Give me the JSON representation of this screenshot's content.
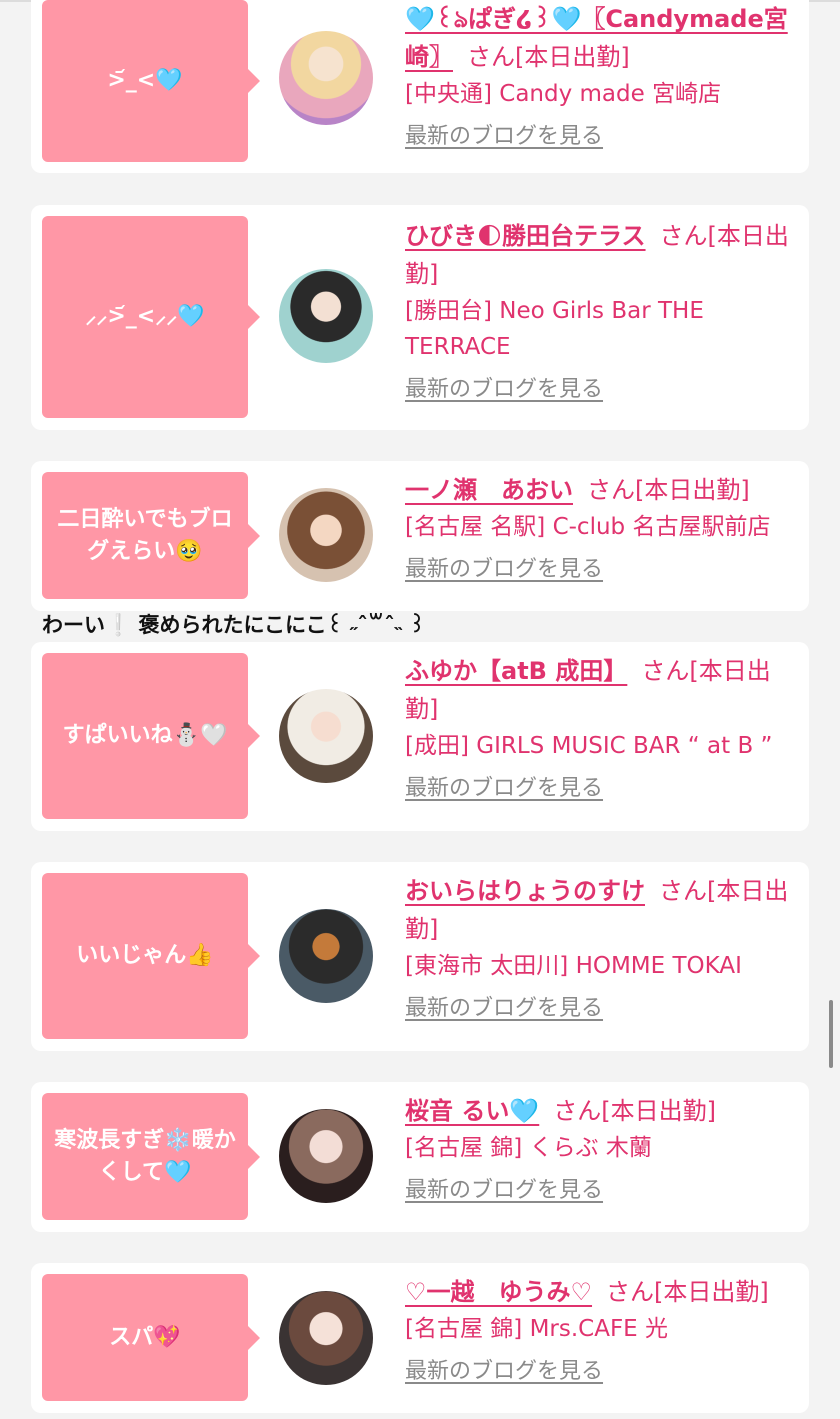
{
  "colors": {
    "accent": "#e0336e",
    "bubble": "#ff97a6",
    "link_gray": "#8a8a8a"
  },
  "between_text": "わーい❕ 褒められたにこにこ꒰ ˶ˆ꒳ˆ˵ ꒱",
  "posts": [
    {
      "bubble": ">᷄_<🩵",
      "name": "🩵꒰ঌぱぎ໒꒱🩵〖Candymade宮崎〗",
      "san": "さん[本日出勤]",
      "shop": "[中央通] Candy made 宮崎店",
      "blog": "最新のブログを見る",
      "avatar_icon": "avatar-photo"
    },
    {
      "bubble": "⸝⸝>᷄_<⸝⸝🩵",
      "name": "ひびき🌓勝田台テラス",
      "san": "さん[本日出勤]",
      "shop": "[勝田台] Neo Girls Bar THE TERRACE",
      "blog": "最新のブログを見る",
      "avatar_icon": "avatar-photo"
    },
    {
      "bubble": "二日酔いでもブログえらい🥹",
      "name": "一ノ瀬　あおい",
      "san": "さん[本日出勤]",
      "shop": "[名古屋 名駅] C-club 名古屋駅前店",
      "blog": "最新のブログを見る",
      "avatar_icon": "avatar-photo"
    },
    {
      "bubble": "すぱいいね⛄🤍",
      "name": "ふゆか【atB 成田】",
      "san": "さん[本日出勤]",
      "shop": "[成田] GIRLS MUSIC BAR “ at B ”",
      "blog": "最新のブログを見る",
      "avatar_icon": "avatar-photo"
    },
    {
      "bubble": "いいじゃん👍",
      "name": "おいらはりょうのすけ",
      "san": "さん[本日出勤]",
      "shop": "[東海市 太田川] HOMME TOKAI",
      "blog": "最新のブログを見る",
      "avatar_icon": "avatar-photo"
    },
    {
      "bubble": "寒波長すぎ❄️暖かくして🩵",
      "name": "桜音 るい🩵",
      "san": "さん[本日出勤]",
      "shop": "[名古屋 錦] くらぶ 木蘭",
      "blog": "最新のブログを見る",
      "avatar_icon": "avatar-photo"
    },
    {
      "bubble": "スパ💖",
      "name": "♡一越　ゆうみ♡",
      "san": "さん[本日出勤]",
      "shop": "[名古屋 錦] Mrs.CAFE 光",
      "blog": "最新のブログを見る",
      "avatar_icon": "avatar-photo"
    }
  ]
}
